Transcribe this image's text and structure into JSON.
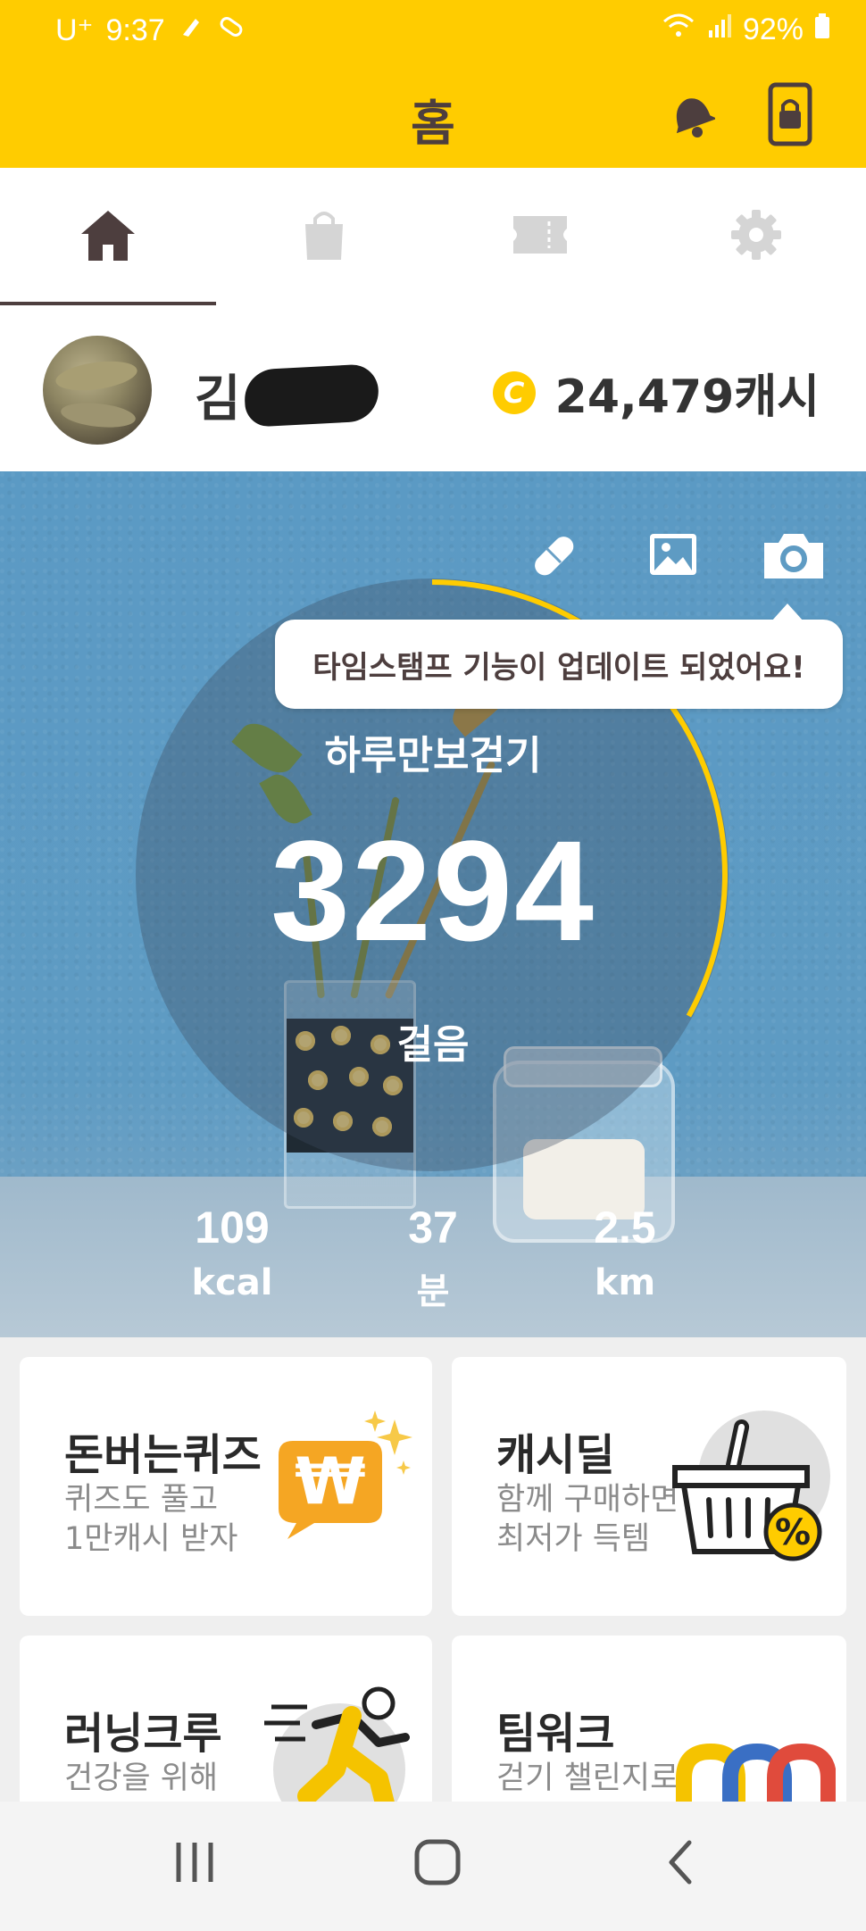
{
  "status_bar": {
    "carrier": "U⁺",
    "time": "9:37",
    "battery": "92%"
  },
  "header": {
    "title": "홈"
  },
  "tabs": [
    {
      "name": "home",
      "icon": "home-icon",
      "active": true
    },
    {
      "name": "shop",
      "icon": "shopping-bag-icon",
      "active": false
    },
    {
      "name": "ticket",
      "icon": "ticket-icon",
      "active": false
    },
    {
      "name": "settings",
      "icon": "gear-icon",
      "active": false
    }
  ],
  "profile": {
    "name_visible": "김",
    "cash_symbol": "C",
    "cash_amount": "24,479캐시"
  },
  "hero": {
    "tooltip": "타임스탬프 기능이 업데이트 되었어요!",
    "walk_title": "하루만보걷기",
    "steps": "3294",
    "steps_unit": "걸음",
    "step_goal_fraction": 0.33,
    "stats": [
      {
        "value": "109",
        "unit": "kcal"
      },
      {
        "value": "37",
        "unit": "분"
      },
      {
        "value": "2.5",
        "unit": "km"
      }
    ]
  },
  "cards": [
    {
      "title": "돈버는퀴즈",
      "sub1": "퀴즈도 풀고",
      "sub2": "1만캐시 받자",
      "icon": "quiz-won-icon"
    },
    {
      "title": "캐시딜",
      "sub1": "함께 구매하면",
      "sub2": "최저가 득템",
      "icon": "shopping-basket-discount-icon"
    },
    {
      "title": "러닝크루",
      "sub1": "건강을 위해",
      "sub2": "",
      "icon": "running-person-icon"
    },
    {
      "title": "팀워크",
      "sub1": "걷기 챌린지로",
      "sub2": "",
      "icon": "teamwork-arches-icon"
    }
  ],
  "colors": {
    "brand_yellow": "#ffcc00",
    "brown": "#4d3e3e"
  }
}
